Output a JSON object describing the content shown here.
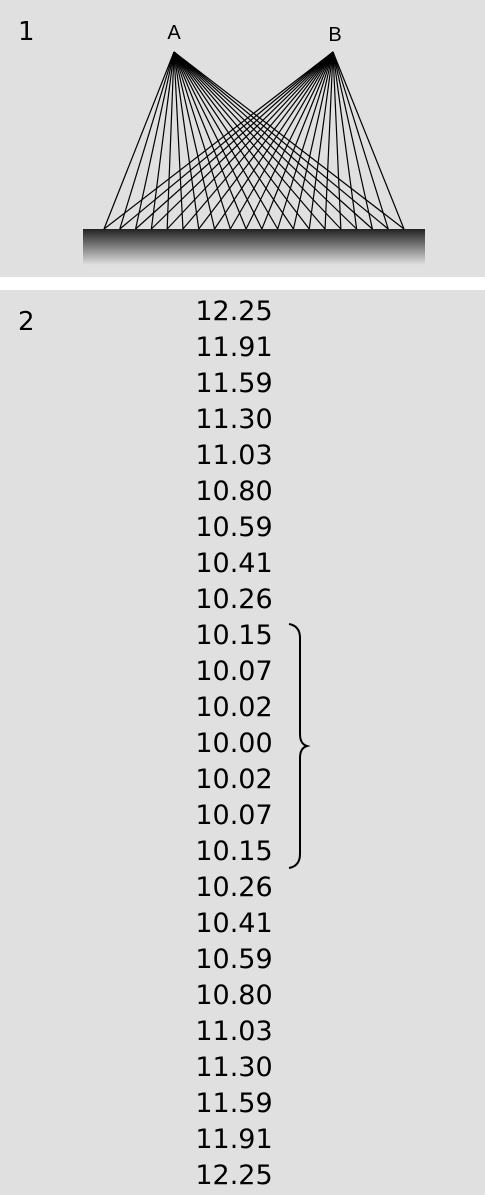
{
  "panels": [
    {
      "number": "1",
      "points": [
        "A",
        "B"
      ],
      "lines_per_point": 20
    },
    {
      "number": "2",
      "values": [
        "12.25",
        "11.91",
        "11.59",
        "11.30",
        "11.03",
        "10.80",
        "10.59",
        "10.41",
        "10.26",
        "10.15",
        "10.07",
        "10.02",
        "10.00",
        "10.02",
        "10.07",
        "10.15",
        "10.26",
        "10.41",
        "10.59",
        "10.80",
        "11.03",
        "11.30",
        "11.59",
        "11.91",
        "12.25"
      ],
      "bracket_first_index": 9,
      "bracket_last_index": 15
    }
  ],
  "colors": {
    "panel_background": "#e0e0e0",
    "page_background": "#ffffff",
    "ink": "#000000",
    "floor_top": "#222222",
    "floor_bottom": "#e0e0e0"
  }
}
